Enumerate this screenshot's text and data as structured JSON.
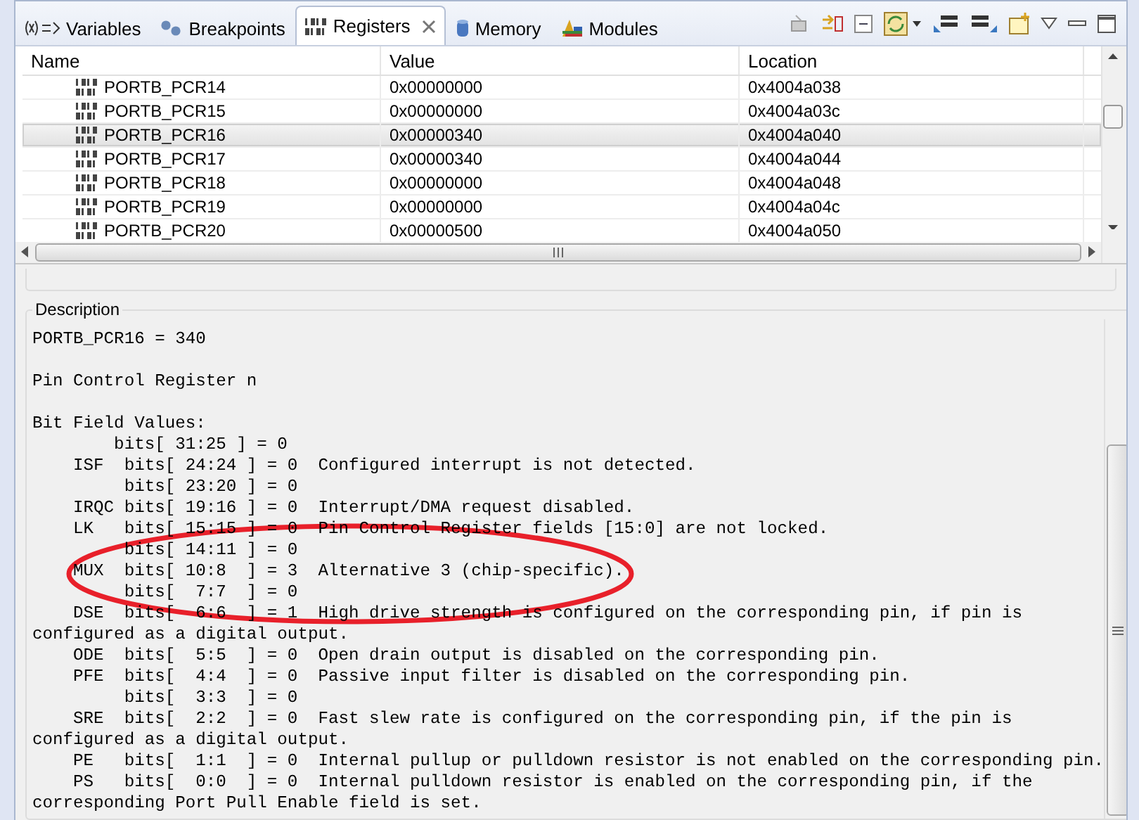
{
  "tabs": [
    {
      "label": "Variables",
      "selected": false,
      "closable": false
    },
    {
      "label": "Breakpoints",
      "selected": false,
      "closable": false
    },
    {
      "label": "Registers",
      "selected": true,
      "closable": true
    },
    {
      "label": "Memory",
      "selected": false,
      "closable": false
    },
    {
      "label": "Modules",
      "selected": false,
      "closable": false
    }
  ],
  "table": {
    "columns": [
      "Name",
      "Value",
      "Location"
    ],
    "rows": [
      {
        "name": "PORTB_PCR14",
        "value": "0x00000000",
        "location": "0x4004a038",
        "selected": false
      },
      {
        "name": "PORTB_PCR15",
        "value": "0x00000000",
        "location": "0x4004a03c",
        "selected": false
      },
      {
        "name": "PORTB_PCR16",
        "value": "0x00000340",
        "location": "0x4004a040",
        "selected": true
      },
      {
        "name": "PORTB_PCR17",
        "value": "0x00000340",
        "location": "0x4004a044",
        "selected": false
      },
      {
        "name": "PORTB_PCR18",
        "value": "0x00000000",
        "location": "0x4004a048",
        "selected": false
      },
      {
        "name": "PORTB_PCR19",
        "value": "0x00000000",
        "location": "0x4004a04c",
        "selected": false
      },
      {
        "name": "PORTB_PCR20",
        "value": "0x00000500",
        "location": "0x4004a050",
        "selected": false
      }
    ]
  },
  "description": {
    "title": "Description",
    "blocks": [
      [
        "PORTB_PCR16 = 340"
      ],
      [
        "Pin Control Register n"
      ],
      [
        "Bit Field Values:",
        "        bits[ 31:25 ] = 0",
        "    ISF  bits[ 24:24 ] = 0  Configured interrupt is not detected.",
        "         bits[ 23:20 ] = 0",
        "    IRQC bits[ 19:16 ] = 0  Interrupt/DMA request disabled.",
        "    LK   bits[ 15:15 ] = 0  Pin Control Register fields [15:0] are not locked.",
        "         bits[ 14:11 ] = 0",
        "    MUX  bits[ 10:8  ] = 3  Alternative 3 (chip-specific).",
        "         bits[  7:7  ] = 0",
        "    DSE  bits[  6:6  ] = 1  High drive strength is configured on the corresponding pin, if pin is",
        "configured as a digital output.",
        "    ODE  bits[  5:5  ] = 0  Open drain output is disabled on the corresponding pin.",
        "    PFE  bits[  4:4  ] = 0  Passive input filter is disabled on the corresponding pin.",
        "         bits[  3:3  ] = 0",
        "    SRE  bits[  2:2  ] = 0  Fast slew rate is configured on the corresponding pin, if the pin is",
        "configured as a digital output.",
        "    PE   bits[  1:1  ] = 0  Internal pullup or pulldown resistor is not enabled on the corresponding pin.",
        "    PS   bits[  0:0  ] = 0  Internal pulldown resistor is enabled on the corresponding pin, if the",
        "corresponding Port Pull Enable field is set."
      ]
    ]
  }
}
